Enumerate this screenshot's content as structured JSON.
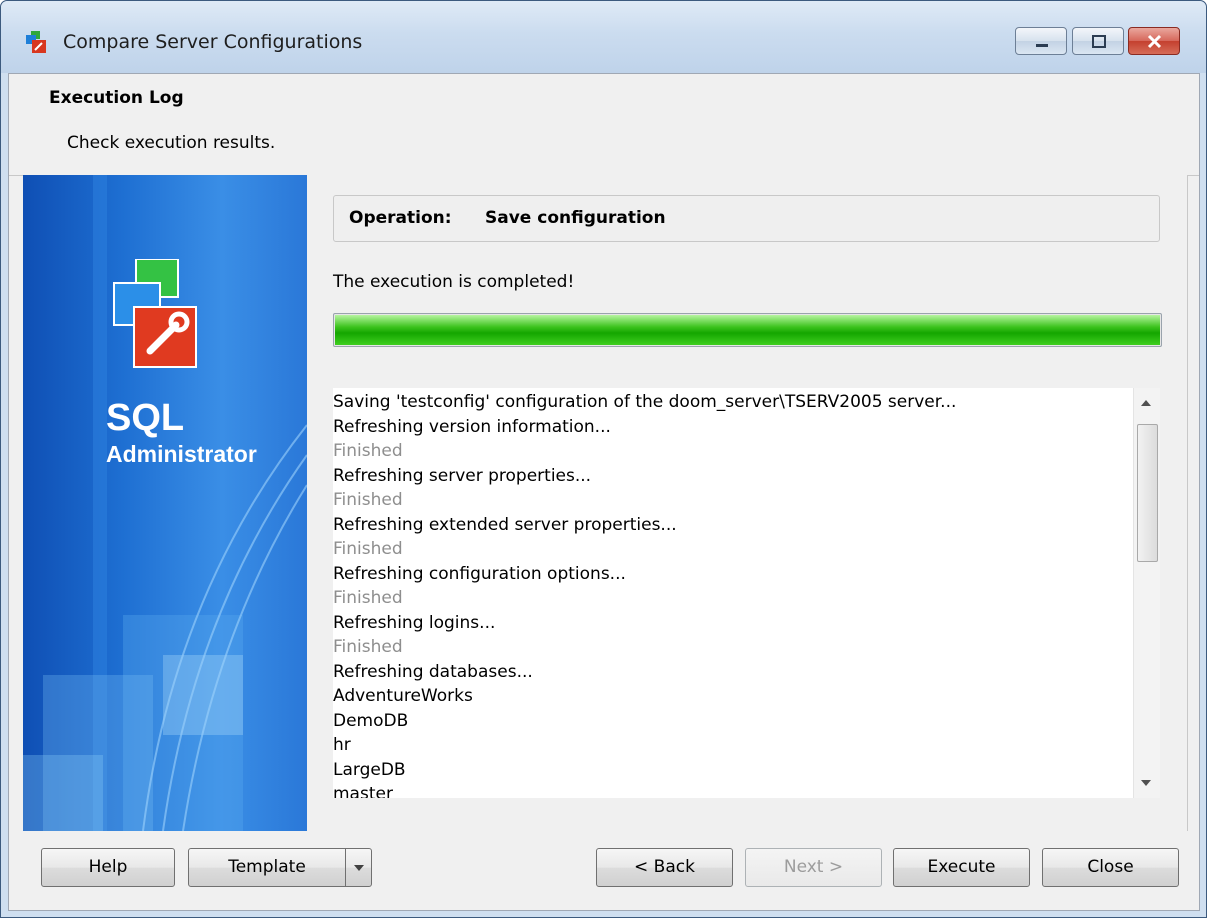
{
  "window": {
    "title": "Compare Server Configurations"
  },
  "header": {
    "title": "Execution Log",
    "subtitle": "Check execution results."
  },
  "banner": {
    "product_line1": "SQL",
    "product_line2": "Administrator"
  },
  "main": {
    "operation_label": "Operation:",
    "operation_value": "Save configuration",
    "status": "The execution is completed!",
    "progress_percent": 100,
    "log": [
      "Saving 'testconfig' configuration of the doom_server\\TSERV2005 server...",
      "Refreshing version information...",
      "Finished",
      "Refreshing server properties...",
      "Finished",
      "Refreshing extended server properties...",
      "Finished",
      "Refreshing configuration options...",
      "Finished",
      "Refreshing logins...",
      "Finished",
      "Refreshing databases...",
      "AdventureWorks",
      "DemoDB",
      "hr",
      "LargeDB",
      "master"
    ]
  },
  "buttons": {
    "help": "Help",
    "template": "Template",
    "back": "< Back",
    "next": "Next >",
    "execute": "Execute",
    "close": "Close"
  }
}
